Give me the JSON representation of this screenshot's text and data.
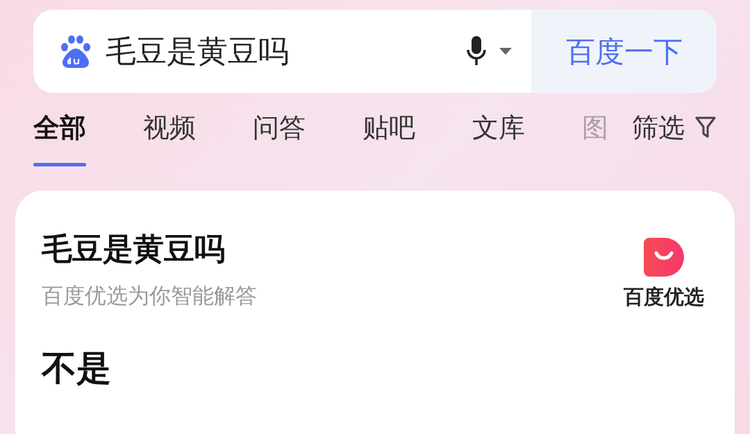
{
  "search": {
    "value": "毛豆是黄豆吗",
    "button": "百度一下"
  },
  "tabs": [
    {
      "label": "全部",
      "selected": true
    },
    {
      "label": "视频",
      "selected": false
    },
    {
      "label": "问答",
      "selected": false
    },
    {
      "label": "贴吧",
      "selected": false
    },
    {
      "label": "文库",
      "selected": false
    },
    {
      "label": "图",
      "selected": false
    }
  ],
  "filter": {
    "label": "筛选"
  },
  "card": {
    "title": "毛豆是黄豆吗",
    "subtitle": "百度优选为你智能解答",
    "brand": "百度优选",
    "answer": "不是"
  }
}
